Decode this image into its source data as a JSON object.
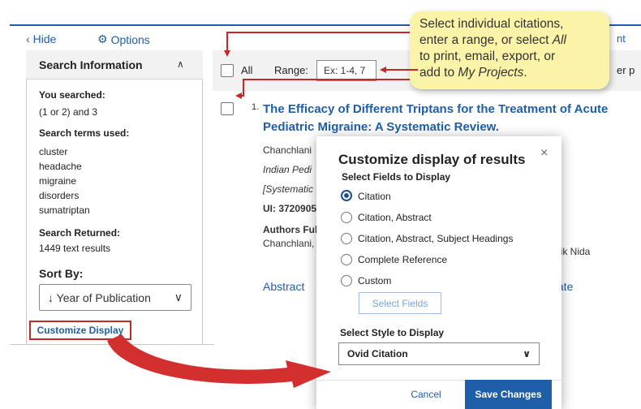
{
  "colors": {
    "link": "#1f5ea8",
    "accent_red": "#c62828",
    "callout_bg": "#fbf3a8",
    "primary_button": "#1f5ea8"
  },
  "left": {
    "hide": "Hide",
    "options": "Options",
    "panel_title": "Search Information",
    "you_searched_label": "You searched:",
    "you_searched_value": "(1 or 2) and 3",
    "terms_label": "Search terms used:",
    "terms": [
      "cluster",
      "headache",
      "migraine",
      "disorders",
      "sumatriptan"
    ],
    "returned_label": "Search Returned:",
    "returned_value": "1449 text results",
    "sort_by": "Sort By:",
    "sort_value": "↓ Year of Publication",
    "customize": "Customize Display"
  },
  "toolbar": {
    "all": "All",
    "range_label": "Range:",
    "range_placeholder": "Ex: 1-4, 7",
    "trunc_right": "er p",
    "trunc_top": "nt"
  },
  "result": {
    "number": "1.",
    "title": "The Efficacy of Different Triptans for the Treatment of Acute Pediatric Migraine: A Systematic Review.",
    "author": "Chanchlani",
    "journal": "Indian Pedi",
    "type": "[Systematic",
    "ui": "UI: 3720905",
    "authors_full": "Authors Ful",
    "authors_full_value": "Chanchlani,",
    "trunc_name": "aik Nida",
    "abstract": "Abstract",
    "trunc_link": "tate"
  },
  "modal": {
    "title": "Customize display of results",
    "close": "×",
    "fields_label": "Select Fields to Display",
    "options": [
      {
        "label": "Citation",
        "selected": true
      },
      {
        "label": "Citation, Abstract",
        "selected": false
      },
      {
        "label": "Citation, Abstract, Subject Headings",
        "selected": false
      },
      {
        "label": "Complete Reference",
        "selected": false
      },
      {
        "label": "Custom",
        "selected": false
      }
    ],
    "select_fields": "Select Fields",
    "style_label": "Select Style to Display",
    "style_value": "Ovid Citation",
    "cancel": "Cancel",
    "save": "Save Changes"
  },
  "callout": {
    "line1": "Select individual citations,",
    "line2": "enter a range, or select ",
    "line2_em": "All",
    "line3": "to print, email, export, or",
    "line4": "add to ",
    "line4_em": "My Projects",
    "line4_end": "."
  }
}
